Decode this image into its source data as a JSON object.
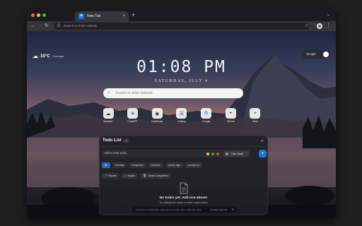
{
  "browser": {
    "tab": {
      "favicon": "+",
      "title": "New Tab",
      "close": "×"
    },
    "new_tab": "+",
    "tab_menu": "⌄",
    "nav": {
      "back": "←",
      "forward": "→",
      "reload": "↻"
    },
    "omnibox": {
      "icon": "G",
      "placeholder": "Search or enter website"
    },
    "star": "☆",
    "kebab": "⋮"
  },
  "weather": {
    "icon": "cloud-icon",
    "glyph": "☁",
    "temperature": "10°C",
    "condition": "Overcast"
  },
  "theme_toggle": {
    "label": "Simple"
  },
  "clock": {
    "time": "01:08 PM",
    "date": "SATURDAY, JULY 4"
  },
  "search": {
    "icon": "⌕",
    "placeholder": "Search or enter website"
  },
  "shortcuts": [
    {
      "label": "Weather",
      "glyph": "☁",
      "icon": "cloud-icon"
    },
    {
      "label": "ChatGPT",
      "glyph": "✳",
      "icon": "chatgpt-icon"
    },
    {
      "label": "DuckDuck",
      "glyph": "◉",
      "icon": "duck-icon"
    },
    {
      "label": "Gallery",
      "glyph": "☰",
      "icon": "gallery-icon"
    },
    {
      "label": "Google",
      "glyph": "G",
      "icon": "google-icon"
    },
    {
      "label": "GitHub",
      "glyph": "◓",
      "icon": "github-icon"
    },
    {
      "label": "New",
      "glyph": "+",
      "icon": "plus-icon"
    }
  ],
  "todo": {
    "title": "Todo List",
    "count": "0",
    "collapse": "⊖",
    "add_placeholder": "Add a new todo...",
    "priority_colors": [
      "#f4c542",
      "#34a853",
      "#ea4335"
    ],
    "due_icon": "▦",
    "due_label": "Due Date",
    "add_button": "+",
    "filters": [
      "All",
      "Pending",
      "Completed",
      "Overdue",
      "priority:high",
      "priority:low"
    ],
    "actions": [
      {
        "icon": "↗",
        "label": "Export"
      },
      {
        "icon": "↙",
        "label": "Import"
      },
      {
        "icon": "🗑",
        "label": "Clear Completed"
      }
    ],
    "empty_title": "No todos yet. Add one above!",
    "empty_subtitle": "Try adding due dates to better organization",
    "footer": {
      "text": "Ctrl+Enter to add quickly, drag todos to reorder them, shift+click select",
      "mode": "Timeline View Off",
      "refresh": "↻"
    }
  }
}
